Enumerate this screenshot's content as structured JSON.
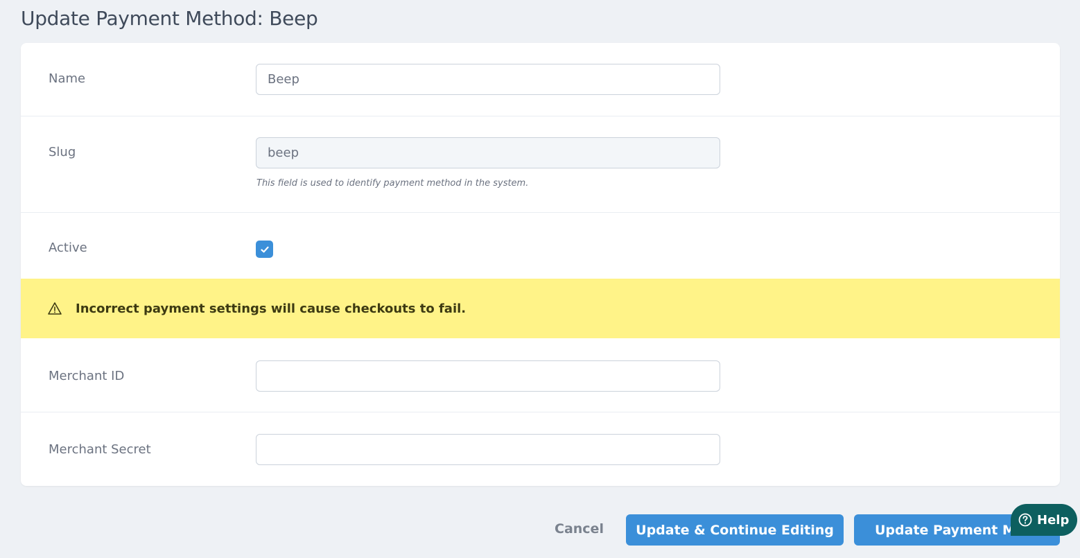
{
  "page": {
    "title": "Update Payment Method: Beep"
  },
  "form": {
    "name": {
      "label": "Name",
      "value": "Beep"
    },
    "slug": {
      "label": "Slug",
      "value": "beep",
      "help": "This field is used to identify payment method in the system."
    },
    "active": {
      "label": "Active",
      "checked": true
    },
    "warning": {
      "icon": "warning-triangle-icon",
      "text": "Incorrect payment settings will cause checkouts to fail."
    },
    "merchant_id": {
      "label": "Merchant ID",
      "value": ""
    },
    "merchant_secret": {
      "label": "Merchant Secret",
      "value": ""
    }
  },
  "footer": {
    "cancel_label": "Cancel",
    "continue_label": "Update & Continue Editing",
    "update_label": "Update Payment Method"
  },
  "help_widget": {
    "label": "Help",
    "icon": "question-circle-icon"
  },
  "colors": {
    "accent": "#3b8fd9",
    "warning_bg": "#fff388",
    "help_bg": "#0d5f5f",
    "page_bg": "#eef1f5"
  }
}
